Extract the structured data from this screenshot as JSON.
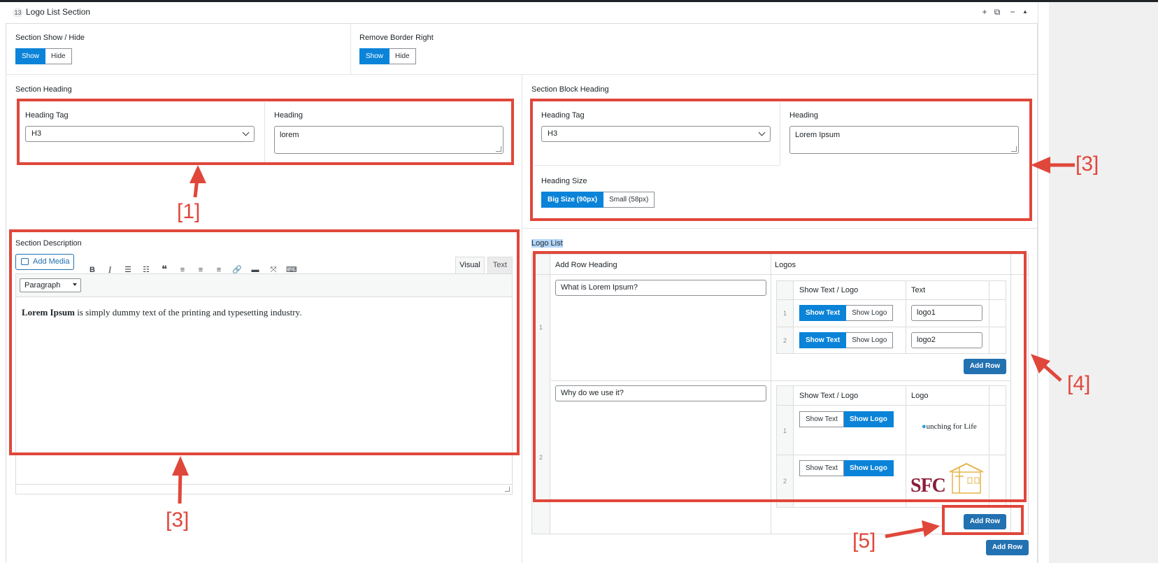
{
  "section": {
    "number": "13",
    "title": "Logo List Section"
  },
  "header_icons": [
    "plus-icon",
    "duplicate-icon",
    "minus-icon",
    "collapse-icon"
  ],
  "show_hide": {
    "label": "Section Show / Hide",
    "options": [
      "Show",
      "Hide"
    ],
    "selected": "Show"
  },
  "border_right": {
    "label": "Remove Border Right",
    "options": [
      "Show",
      "Hide"
    ],
    "selected": "Show"
  },
  "section_heading": {
    "label": "Section Heading",
    "tag_label": "Heading Tag",
    "tag_value": "H3",
    "heading_label": "Heading",
    "heading_value": "lorem"
  },
  "block_heading": {
    "label": "Section Block Heading",
    "tag_label": "Heading Tag",
    "tag_value": "H3",
    "heading_label": "Heading",
    "heading_value": "Lorem Ipsum",
    "size_label": "Heading Size",
    "size_options": [
      "Big Size (90px)",
      "Small (58px)"
    ],
    "size_selected": "Big Size (90px)"
  },
  "description": {
    "label": "Section Description",
    "add_media": "Add Media",
    "tab_visual": "Visual",
    "tab_text": "Text",
    "format": "Paragraph",
    "content_bold": "Lorem Ipsum",
    "content_rest": " is simply dummy text of the printing and typesetting industry."
  },
  "logo_list": {
    "label": "Logo List",
    "col_heading": "Add Row Heading",
    "col_logos": "Logos",
    "rows": [
      {
        "num": "1",
        "heading": "What is Lorem Ipsum?",
        "sub_col1": "Show Text / Logo",
        "sub_col2": "Text",
        "items": [
          {
            "num": "1",
            "options": [
              "Show Text",
              "Show Logo"
            ],
            "selected": "Show Text",
            "value": "logo1"
          },
          {
            "num": "2",
            "options": [
              "Show Text",
              "Show Logo"
            ],
            "selected": "Show Text",
            "value": "logo2"
          }
        ],
        "add_row": "Add Row"
      },
      {
        "num": "2",
        "heading": "Why do we use it?",
        "sub_col1": "Show Text / Logo",
        "sub_col2": "Logo",
        "items": [
          {
            "num": "1",
            "options": [
              "Show Text",
              "Show Logo"
            ],
            "selected": "Show Logo",
            "logo": "unching for Life"
          },
          {
            "num": "2",
            "options": [
              "Show Text",
              "Show Logo"
            ],
            "selected": "Show Logo",
            "logo": "SFC"
          }
        ],
        "add_row": "Add Row"
      }
    ],
    "outer_add_row": "Add Row"
  },
  "annotations": [
    "[1]",
    "[3]",
    "[3]",
    "[4]",
    "[5]"
  ],
  "annotation_color": "#e0473b",
  "accent_color": "#0a83d8"
}
